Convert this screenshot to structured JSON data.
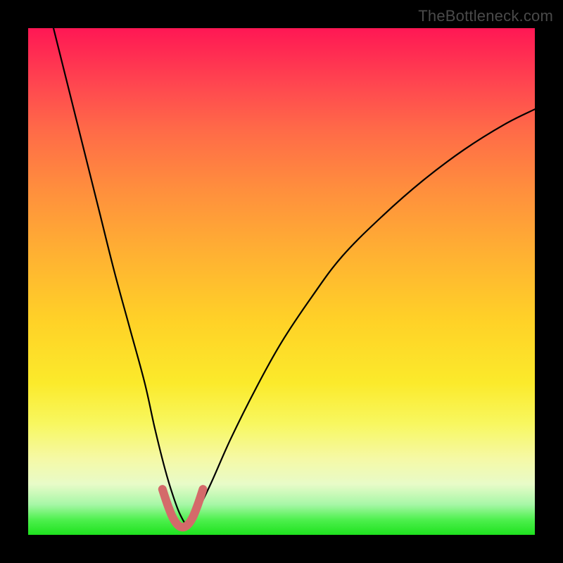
{
  "watermark": {
    "text": "TheBottleneck.com"
  },
  "chart_data": {
    "type": "line",
    "title": "",
    "xlabel": "",
    "ylabel": "",
    "xlim": [
      0,
      100
    ],
    "ylim": [
      0,
      100
    ],
    "grid": false,
    "legend": false,
    "series": [
      {
        "name": "bottleneck-curve",
        "color": "#000000",
        "x": [
          5,
          8,
          11,
          14,
          17,
          20,
          23,
          25,
          27,
          28.5,
          30,
          31.5,
          33,
          36,
          40,
          45,
          50,
          56,
          62,
          70,
          78,
          86,
          94,
          100
        ],
        "values": [
          100,
          88,
          76,
          64,
          52,
          41,
          30,
          21,
          13,
          8,
          4,
          2,
          4,
          10,
          19,
          29,
          38,
          47,
          55,
          63,
          70,
          76,
          81,
          84
        ]
      },
      {
        "name": "optimal-zone-highlight",
        "color": "#d46a6a",
        "x": [
          26.5,
          27.5,
          28.5,
          29.5,
          30.5,
          31.5,
          32.5,
          33.5,
          34.5
        ],
        "values": [
          9,
          6,
          3.5,
          2,
          1.5,
          2,
          3.5,
          6,
          9
        ]
      }
    ],
    "notes": "V-shaped bottleneck curve on a heat gradient. Minimum near x≈30 (bottleneck ≈0). Left branch rises toward 100% as x→5; right branch rises toward ~84% as x→100. Pink highlight marks the trough (optimal region)."
  }
}
